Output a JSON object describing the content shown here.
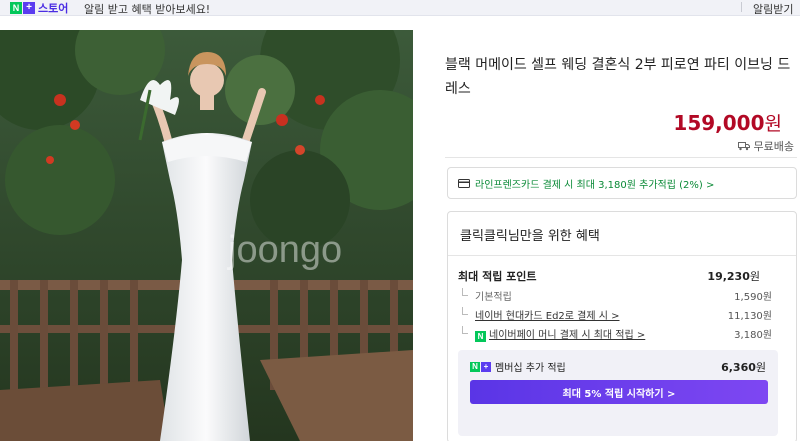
{
  "topbar": {
    "logo_n": "N",
    "logo_plus": "+",
    "store_label": "스토어",
    "message": "알림 받고 혜택 받아보세요!",
    "right_button": "알림받기"
  },
  "photo": {
    "watermark": "joongo"
  },
  "product": {
    "title": "블랙 머메이드 셀프 웨딩 결혼식 2부 피로연 파티 이브닝 드레스",
    "price": "159,000",
    "price_unit": "원",
    "shipping": "무료배송"
  },
  "card_offer": {
    "text": "라인프렌즈카드 결제 시 최대 3,180원 추가적립 (2%) >"
  },
  "benefits": {
    "title": "클릭클릭님만을 위한 혜택",
    "max_points_label": "최대 적립 포인트",
    "max_points_value": "19,230",
    "max_points_unit": "원",
    "rows": [
      {
        "label": "기본적립",
        "value": "1,590원"
      },
      {
        "label": "네이버 현대카드 Ed2로 결제 시 >",
        "value": "11,130원"
      },
      {
        "label": "네이버페이 머니 결제 시 최대 적립 >",
        "value": "3,180원"
      }
    ],
    "membership_label": "멤버십 추가 적립",
    "membership_value": "6,360",
    "membership_unit": "원",
    "membership_button": "최대 5% 적립 시작하기 >"
  },
  "colors": {
    "price": "#b20925",
    "naver_green": "#03c75a",
    "plus_purple": "#5b3cf0"
  }
}
